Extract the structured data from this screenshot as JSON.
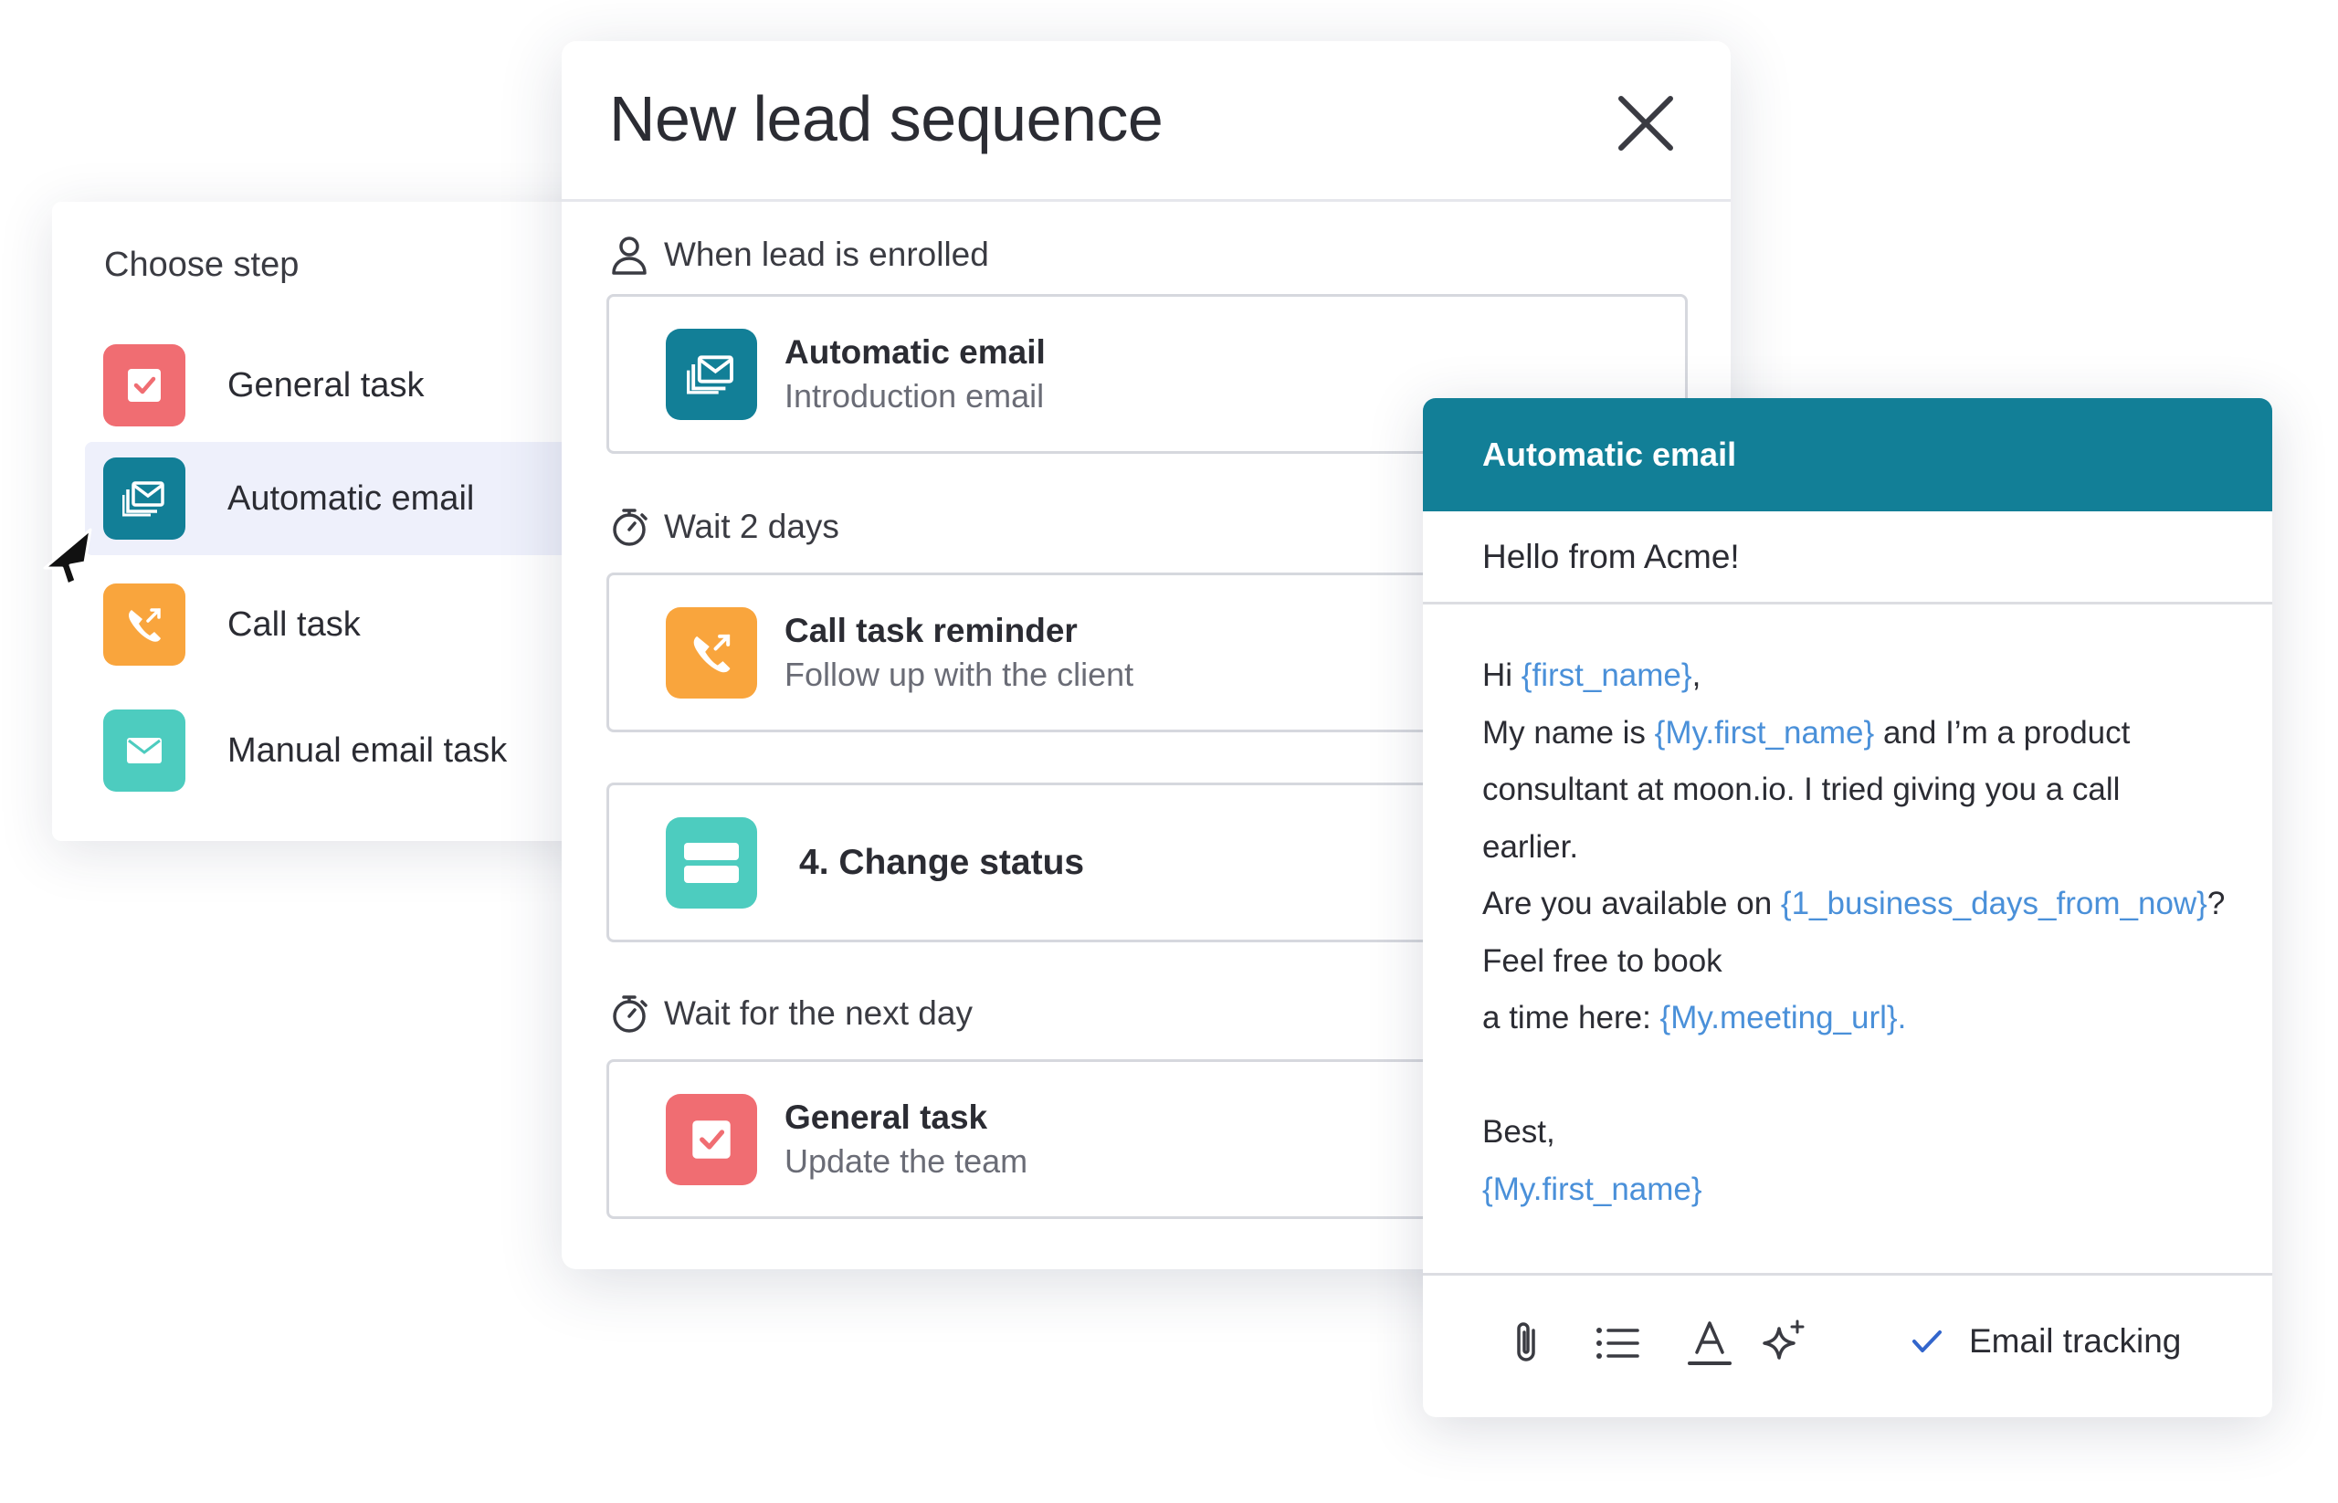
{
  "chooser": {
    "title": "Choose step",
    "items": [
      {
        "label": "General task",
        "icon": "checkbox-icon",
        "color": "#f06d72"
      },
      {
        "label": "Automatic email",
        "icon": "email-stack-icon",
        "color": "#127f97",
        "selected": true
      },
      {
        "label": "Call task",
        "icon": "phone-icon",
        "color": "#f9a53d"
      },
      {
        "label": "Manual email task",
        "icon": "envelope-icon",
        "color": "#4dccbf"
      }
    ]
  },
  "modal": {
    "title": "New lead sequence",
    "steps": [
      {
        "trigger": "When lead is enrolled",
        "trigger_icon": "person-icon",
        "title": "Automatic email",
        "subtitle": "Introduction email"
      },
      {
        "trigger": "Wait 2 days",
        "trigger_icon": "stopwatch-icon",
        "title": "Call task reminder",
        "subtitle": "Follow up with the client"
      },
      {
        "title": "4. Change status"
      },
      {
        "trigger": "Wait for the next day",
        "trigger_icon": "stopwatch-icon",
        "title": "General task",
        "subtitle": "Update the team"
      }
    ]
  },
  "email": {
    "header": "Automatic email",
    "subject": "Hello from Acme!",
    "body": {
      "l1a": "Hi ",
      "l1v": "{first_name}",
      "l1b": ",",
      "l2a": "My name is ",
      "l2v": "{My.first_name}",
      "l2b": " and I’m a product",
      "l3": "consultant at moon.io. I tried giving you a call",
      "l4": "earlier.",
      "l5a": "Are you available on ",
      "l5v": "{1_business_days_from_now}",
      "l5b": "?",
      "l6": "Feel free to book",
      "l7a": "a time here: ",
      "l7v": "{My.meeting_url}.",
      "l8": "Best,",
      "l9v": "{My.first_name}"
    },
    "tracking_label": "Email tracking",
    "tracking_checked": true
  },
  "colors": {
    "accent": "#127f97",
    "variable": "#4a90d9"
  }
}
